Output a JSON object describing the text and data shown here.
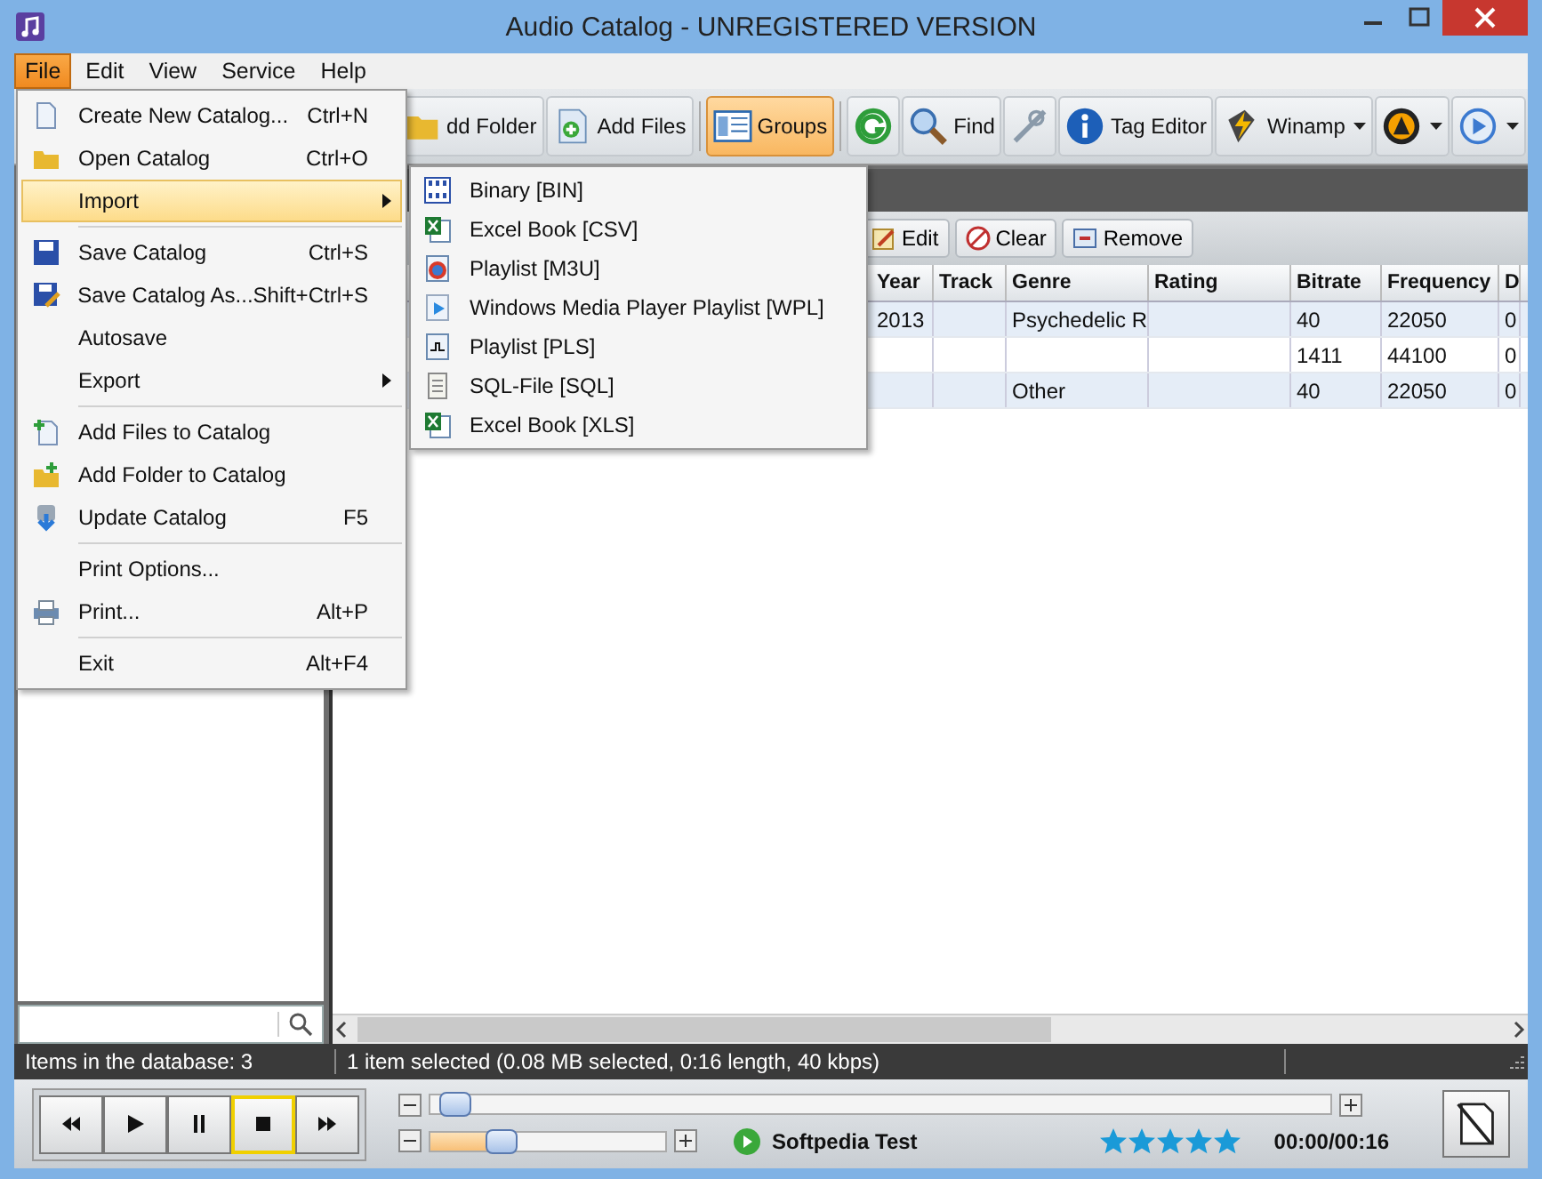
{
  "window": {
    "title": "Audio Catalog - UNREGISTERED VERSION"
  },
  "menu_bar": [
    {
      "label": "File",
      "selected": true
    },
    {
      "label": "Edit",
      "selected": false
    },
    {
      "label": "View",
      "selected": false
    },
    {
      "label": "Service",
      "selected": false
    },
    {
      "label": "Help",
      "selected": false
    }
  ],
  "toolbar": [
    {
      "kind": "button",
      "label": "dd Folder",
      "selected": false
    },
    {
      "kind": "button",
      "label": "Add Files",
      "selected": false
    },
    {
      "kind": "button",
      "label": "Groups",
      "selected": true
    },
    {
      "kind": "icon",
      "selected": false
    },
    {
      "kind": "button",
      "label": "Find",
      "selected": false
    },
    {
      "kind": "icon",
      "selected": false
    },
    {
      "kind": "button",
      "label": "Tag Editor",
      "selected": false
    },
    {
      "kind": "dropdown",
      "label": "Winamp",
      "selected": false
    },
    {
      "kind": "dropdown",
      "selected": false
    },
    {
      "kind": "dropdown",
      "selected": false
    }
  ],
  "file_menu": [
    {
      "kind": "item",
      "label": "Create New Catalog...",
      "shortcut": "Ctrl+N",
      "selected": false
    },
    {
      "kind": "item",
      "label": "Open Catalog",
      "shortcut": "Ctrl+O",
      "selected": false
    },
    {
      "kind": "submenu",
      "label": "Import",
      "selected": true
    },
    {
      "kind": "separator"
    },
    {
      "kind": "item",
      "label": "Save Catalog",
      "shortcut": "Ctrl+S",
      "selected": false
    },
    {
      "kind": "item",
      "label": "Save Catalog As...",
      "shortcut": "Shift+Ctrl+S",
      "selected": false
    },
    {
      "kind": "item",
      "label": "Autosave",
      "selected": false
    },
    {
      "kind": "submenu",
      "label": "Export",
      "selected": false
    },
    {
      "kind": "separator"
    },
    {
      "kind": "item",
      "label": "Add Files to Catalog",
      "selected": false
    },
    {
      "kind": "item",
      "label": "Add Folder to Catalog",
      "selected": false
    },
    {
      "kind": "item",
      "label": "Update Catalog",
      "shortcut": "F5",
      "selected": false
    },
    {
      "kind": "separator"
    },
    {
      "kind": "item",
      "label": "Print Options...",
      "selected": false
    },
    {
      "kind": "item",
      "label": "Print...",
      "shortcut": "Alt+P",
      "selected": false
    },
    {
      "kind": "separator"
    },
    {
      "kind": "item",
      "label": "Exit",
      "shortcut": "Alt+F4",
      "selected": false
    }
  ],
  "import_submenu": [
    "Binary [BIN]",
    "Excel Book [CSV]",
    "Playlist [M3U]",
    "Windows Media Player Playlist [WPL]",
    "Playlist [PLS]",
    "SQL-File [SQL]",
    "Excel Book [XLS]"
  ],
  "list_toolbar": [
    "Edit",
    "Clear",
    "Remove"
  ],
  "table": {
    "columns": [
      "Year",
      "Track",
      "Genre",
      "Rating",
      "Bitrate",
      "Frequency",
      "D"
    ],
    "rows": [
      [
        "2013",
        "",
        "Psychedelic R",
        "",
        "40",
        "22050",
        "0"
      ],
      [
        "",
        "",
        "",
        "",
        "1411",
        "44100",
        "0"
      ],
      [
        "",
        "",
        "Other",
        "",
        "40",
        "22050",
        "0"
      ]
    ]
  },
  "status_bar": {
    "left": "Items in the database: 3",
    "right": "1 item selected (0.08 MB selected, 0:16 length, 40 kbps)"
  },
  "player": {
    "controls": [
      {
        "kind": "rewind",
        "selected": false
      },
      {
        "kind": "play",
        "selected": false
      },
      {
        "kind": "pause",
        "selected": false
      },
      {
        "kind": "stop",
        "selected": true
      },
      {
        "kind": "forward",
        "selected": false
      }
    ],
    "position": {
      "level": 0.01
    },
    "volume": {
      "level": 0.3
    },
    "track": "Softpedia Test",
    "stars": 5,
    "time": "00:00/00:16"
  }
}
